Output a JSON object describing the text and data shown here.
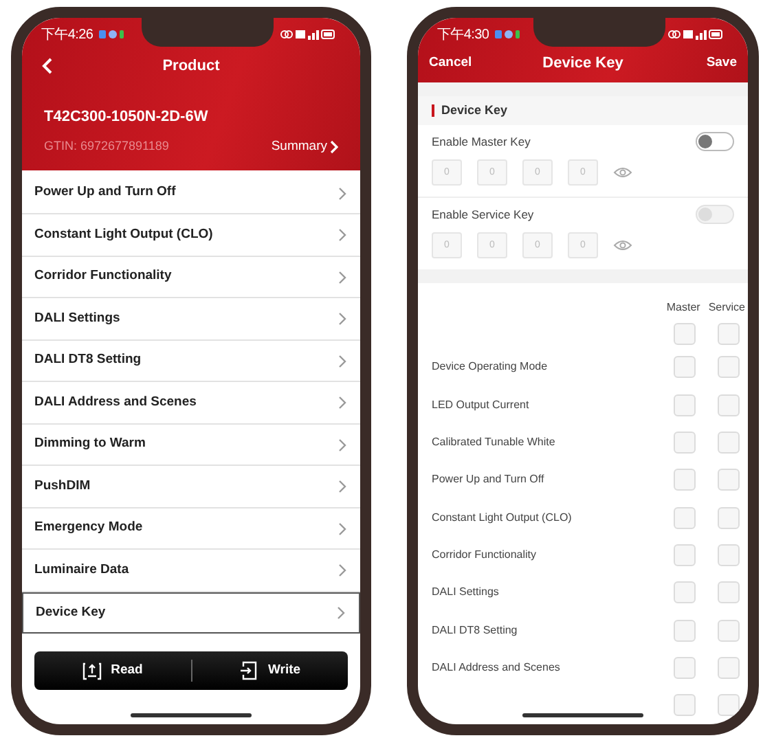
{
  "left_screen": {
    "status_bar": {
      "time": "下午4:26"
    },
    "nav": {
      "title": "Product"
    },
    "product": {
      "model": "T42C300-1050N-2D-6W",
      "gtin": "GTIN: 6972677891189",
      "summary_link": "Summary"
    },
    "menu": [
      {
        "label": "Power Up and Turn Off",
        "selected": false
      },
      {
        "label": "Constant Light Output (CLO)",
        "selected": false
      },
      {
        "label": "Corridor Functionality",
        "selected": false
      },
      {
        "label": "DALI Settings",
        "selected": false
      },
      {
        "label": "DALI DT8 Setting",
        "selected": false
      },
      {
        "label": "DALI Address and Scenes",
        "selected": false
      },
      {
        "label": "Dimming to Warm",
        "selected": false
      },
      {
        "label": "PushDIM",
        "selected": false
      },
      {
        "label": "Emergency Mode",
        "selected": false
      },
      {
        "label": "Luminaire Data",
        "selected": false
      },
      {
        "label": "Device Key",
        "selected": true
      }
    ],
    "actions": [
      {
        "kind": "read",
        "label": "Read"
      },
      {
        "kind": "write",
        "label": "Write"
      }
    ]
  },
  "right_screen": {
    "status_bar": {
      "time": "下午4:30"
    },
    "nav": {
      "cancel": "Cancel",
      "title": "Device Key",
      "save": "Save"
    },
    "section_title": "Device Key",
    "keys": [
      {
        "label": "Enable Master Key",
        "on": false,
        "disabled": false,
        "digits": [
          "0",
          "0",
          "0",
          "0"
        ]
      },
      {
        "label": "Enable Service Key",
        "on": false,
        "disabled": true,
        "digits": [
          "0",
          "0",
          "0",
          "0"
        ]
      }
    ],
    "permissions": {
      "columns": [
        "Master",
        "Service"
      ],
      "rows": [
        {
          "master_checked": false,
          "service_checked": false
        },
        {
          "label": "Device Operating Mode",
          "master_checked": false,
          "service_checked": false
        },
        {
          "label": "LED Output Current",
          "master_checked": false,
          "service_checked": false
        },
        {
          "label": "Calibrated Tunable White",
          "master_checked": false,
          "service_checked": false
        },
        {
          "label": "Power Up and Turn Off",
          "master_checked": false,
          "service_checked": false
        },
        {
          "label": "Constant Light Output (CLO)",
          "master_checked": false,
          "service_checked": false
        },
        {
          "label": "Corridor Functionality",
          "master_checked": false,
          "service_checked": false
        },
        {
          "label": "DALI Settings",
          "master_checked": false,
          "service_checked": false
        },
        {
          "label": "DALI DT8 Setting",
          "master_checked": false,
          "service_checked": false
        },
        {
          "label": "DALI Address and Scenes",
          "master_checked": false,
          "service_checked": false
        },
        {
          "master_checked": false,
          "service_checked": false
        }
      ]
    }
  }
}
